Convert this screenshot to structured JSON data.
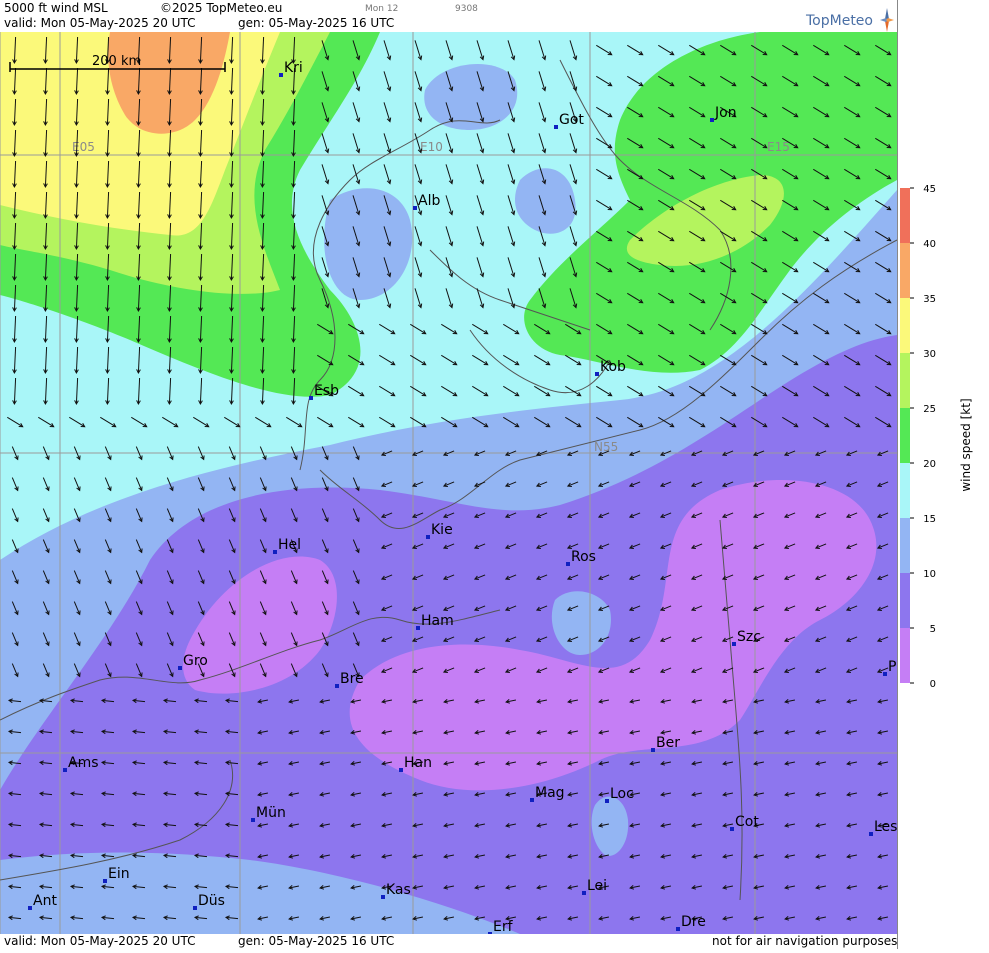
{
  "header": {
    "product": "5000 ft wind MSL",
    "copyright": "©2025 TopMeteo.eu",
    "day_code": "Mon 12",
    "code": "9308",
    "valid": "valid:  Mon  05-May-2025  20 UTC",
    "gen": "gen: 05-May-2025 16 UTC"
  },
  "brand": {
    "logo_text": "TopMeteo"
  },
  "scale_bar": {
    "label": "200 km"
  },
  "footer": {
    "valid": "valid:  Mon  05-May-2025  20 UTC",
    "gen": "gen: 05-May-2025 16 UTC",
    "disclaimer": "not for air navigation purposes"
  },
  "grid_labels": [
    "E05",
    "E10",
    "E15",
    "N55"
  ],
  "legend": {
    "axis_label": "wind speed  [kt]",
    "ticks": [
      0,
      5,
      10,
      15,
      20,
      25,
      30,
      35,
      40,
      45
    ],
    "colors": {
      "0-5": "#c57ef5",
      "5-10": "#8d76ee",
      "10-15": "#93b5f3",
      "15-20": "#a9f6f8",
      "20-25": "#54e855",
      "25-30": "#b4f45e",
      "30-35": "#fbf97a",
      "35-40": "#f9a866",
      "40-45": "#f0705a"
    }
  },
  "cities": [
    {
      "name": "Kri"
    },
    {
      "name": "Got"
    },
    {
      "name": "Jon"
    },
    {
      "name": "Alb"
    },
    {
      "name": "Kob"
    },
    {
      "name": "Esb"
    },
    {
      "name": "Kie"
    },
    {
      "name": "Hel"
    },
    {
      "name": "Ros"
    },
    {
      "name": "Ham"
    },
    {
      "name": "Szc"
    },
    {
      "name": "Gro"
    },
    {
      "name": "Bre"
    },
    {
      "name": "P"
    },
    {
      "name": "Ber"
    },
    {
      "name": "Ams"
    },
    {
      "name": "Han"
    },
    {
      "name": "Mag"
    },
    {
      "name": "Loc"
    },
    {
      "name": "Mün"
    },
    {
      "name": "Cot"
    },
    {
      "name": "Les"
    },
    {
      "name": "Ein"
    },
    {
      "name": "Kas"
    },
    {
      "name": "Lei"
    },
    {
      "name": "Ant"
    },
    {
      "name": "Düs"
    },
    {
      "name": "Dre"
    },
    {
      "name": "Erf"
    }
  ]
}
